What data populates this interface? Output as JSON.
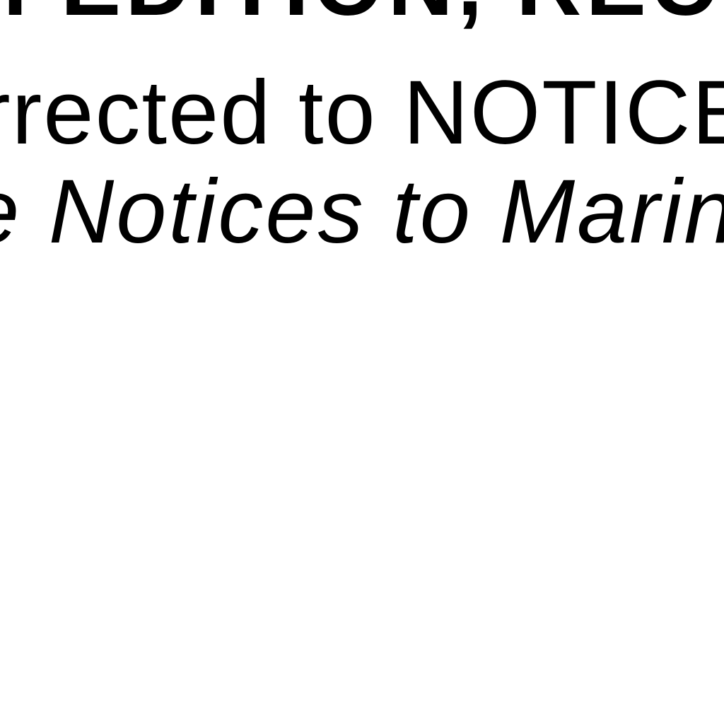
{
  "document": {
    "line_top": "n EDITION, REC",
    "line_corrected": "rrected to NOTICE",
    "line_notices": "e Notices to Marin"
  }
}
